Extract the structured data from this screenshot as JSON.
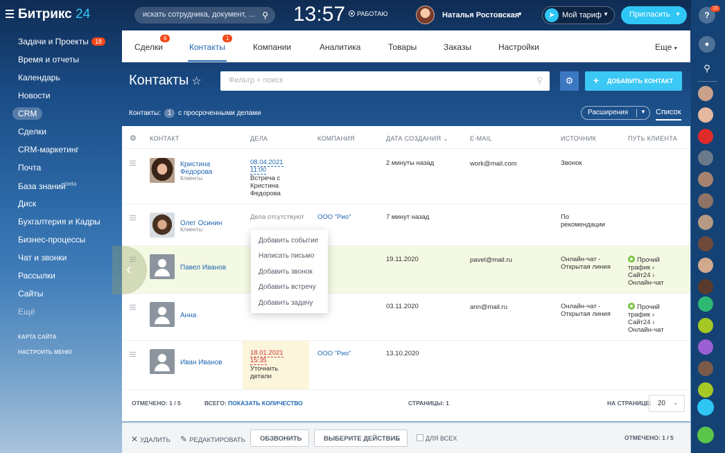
{
  "header": {
    "logo_text": "Битрикс",
    "logo_num": "24",
    "search_placeholder": "искать сотрудника, документ, ...",
    "time": "13:57",
    "work_status": "РАБОТАЮ",
    "user_name": "Наталья Ростовская",
    "tariff_label": "Мой тариф",
    "invite_label": "Пригласить"
  },
  "rail": {
    "help_badge": "15",
    "help_icon": "?"
  },
  "sidebar": {
    "items": [
      {
        "label": "Задачи и Проекты",
        "count": "18"
      },
      {
        "label": "Время и отчеты"
      },
      {
        "label": "Календарь"
      },
      {
        "label": "Новости"
      },
      {
        "label": "CRM"
      },
      {
        "label": "Сделки"
      },
      {
        "label": "CRM-маркетинг"
      },
      {
        "label": "Почта"
      },
      {
        "label": "База знаний",
        "sup": "beta"
      },
      {
        "label": "Диск"
      },
      {
        "label": "Бухгалтерия и Кадры"
      },
      {
        "label": "Бизнес-процессы"
      },
      {
        "label": "Чат и звонки"
      },
      {
        "label": "Рассылки"
      },
      {
        "label": "Сайты"
      },
      {
        "label": "Ещё"
      }
    ],
    "site_map": "КАРТА САЙТА",
    "menu_settings": "НАСТРОИТЬ МЕНЮ"
  },
  "tabs": [
    {
      "label": "Сделки",
      "badge": "6"
    },
    {
      "label": "Контакты",
      "badge": "1"
    },
    {
      "label": "Компании"
    },
    {
      "label": "Аналитика"
    },
    {
      "label": "Товары"
    },
    {
      "label": "Заказы"
    },
    {
      "label": "Настройки"
    },
    {
      "label": "Еще"
    }
  ],
  "page": {
    "title": "Контакты",
    "filter_placeholder": "Фильтр + поиск",
    "add_button": "ДОБАВИТЬ КОНТАКТ",
    "counter_prefix": "Контакты:",
    "counter_num": "1",
    "counter_suffix": "с просроченными делами",
    "extensions": "Расширения",
    "list_view": "Список"
  },
  "grid": {
    "columns": [
      "КОНТАКТ",
      "ДЕЛА",
      "КОМПАНИЯ",
      "ДАТА СОЗДАНИЯ",
      "E-MAIL",
      "ИСТОЧНИК",
      "ПУТЬ КЛИЕНТА"
    ],
    "rows": [
      {
        "name1": "Кристина",
        "name2": "Федорова",
        "type": "Клиенты",
        "deal_date": "08.04.2021",
        "deal_time": "11:00",
        "deal_text1": "Встреча с",
        "deal_text2": "Кристина",
        "deal_text3": "Федорова",
        "created": "2 минуты назад",
        "email": "work@mail.com",
        "source": "Звонок"
      },
      {
        "name1": "Олег Осинин",
        "type": "Клиенты",
        "deal_none": "Дела отсутствуют",
        "company": "ООО \"Рио\"",
        "created": "7 минут назад",
        "source1": "По",
        "source2": "рекомендации"
      },
      {
        "name1": "Павел Иванов",
        "created": "19.11.2020",
        "email": "pavel@mail.ru",
        "source1": "Онлайн-чат -",
        "source2": "Открытая линия",
        "journey1": "Прочий",
        "journey2": "трафик",
        "journey3": "Сайт24",
        "journey4": "Онлайн-чат"
      },
      {
        "name1": "Анна",
        "created": "03.11.2020",
        "email": "ann@mail.ru",
        "source1": "Онлайн-чат -",
        "source2": "Открытая линия",
        "journey1": "Прочий",
        "journey2": "трафик",
        "journey3": "Сайт24",
        "journey4": "Онлайн-чат"
      },
      {
        "name1": "Иван Иванов",
        "deal_date": "18.01.2021",
        "deal_time": "15:35",
        "deal_text1": "Уточнить",
        "deal_text2": "детали",
        "company": "ООО \"Рио\"",
        "created": "13.10.2020"
      }
    ]
  },
  "popup": [
    "Добавить событие",
    "Написать письмо",
    "Добавить звонок",
    "Добавить встречу",
    "Добавить задачу"
  ],
  "footer": {
    "selected_label": "ОТМЕЧЕНО:",
    "selected_value": "1 / 5",
    "total_label": "ВСЕГО:",
    "total_link": "ПОКАЗАТЬ КОЛИЧЕСТВО",
    "pages_label": "СТРАНИЦЫ:",
    "pages_value": "1",
    "per_page_label": "НА СТРАНИЦЕ:",
    "per_page_value": "20"
  },
  "actions": {
    "delete": "УДАЛИТЬ",
    "edit": "РЕДАКТИРОВАТЬ",
    "call": "ОБЗВОНИТЬ",
    "choose_action": "ВЫБЕРИТЕ ДЕЙСТВИЕ",
    "for_all": "ДЛЯ ВСЕХ",
    "selected": "ОТМЕЧЕНО: 1 / 5"
  },
  "colors": {
    "accent": "#2067b0",
    "add_button": "#3bc8f5",
    "badge": "#f54819",
    "highlight_row": "#f3f9e3"
  }
}
